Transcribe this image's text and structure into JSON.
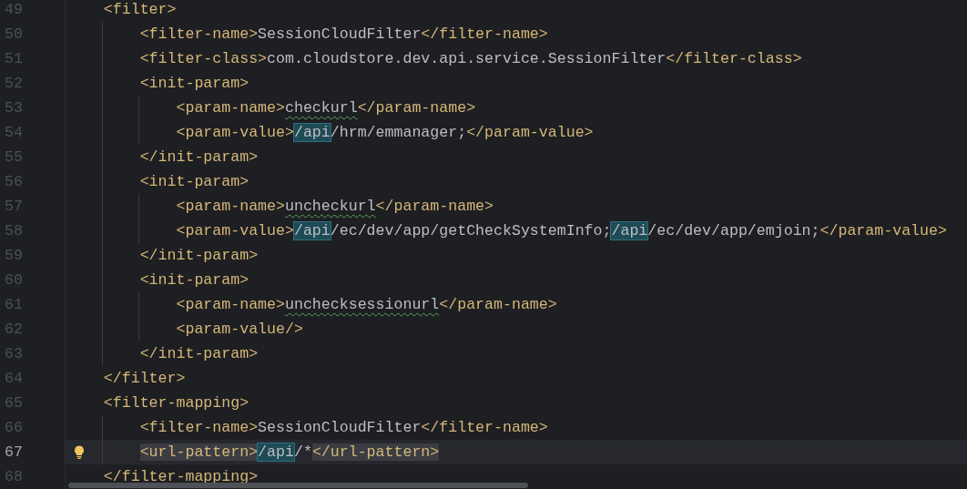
{
  "lines": [
    {
      "number": "49",
      "current": false,
      "tokens": [
        {
          "kind": "tag",
          "text": "<filter>"
        }
      ],
      "children": [
        {
          "number": "50",
          "current": false,
          "tokens": [
            {
              "kind": "tag",
              "text": "<filter-name>"
            },
            {
              "kind": "text",
              "text": "SessionCloudFilter"
            },
            {
              "kind": "tag",
              "text": "</filter-name>"
            }
          ]
        },
        {
          "number": "51",
          "current": false,
          "tokens": [
            {
              "kind": "tag",
              "text": "<filter-class>"
            },
            {
              "kind": "text",
              "text": "com.cloudstore.dev.api.service.SessionFilter"
            },
            {
              "kind": "tag",
              "text": "</filter-class>"
            }
          ]
        },
        {
          "number": "52",
          "current": false,
          "tokens": [
            {
              "kind": "tag",
              "text": "<init-param>"
            }
          ],
          "children": [
            {
              "number": "53",
              "current": false,
              "tokens": [
                {
                  "kind": "tag",
                  "text": "<param-name>"
                },
                {
                  "kind": "typo",
                  "text": "checkurl"
                },
                {
                  "kind": "tag",
                  "text": "</param-name>"
                }
              ]
            },
            {
              "number": "54",
              "current": false,
              "tokens": [
                {
                  "kind": "tag",
                  "text": "<param-value>"
                },
                {
                  "kind": "match",
                  "text": "/api"
                },
                {
                  "kind": "text",
                  "text": "/hrm/emmanager;"
                },
                {
                  "kind": "tag",
                  "text": "</param-value>"
                }
              ]
            }
          ]
        },
        {
          "number": "55",
          "current": false,
          "tokens": [
            {
              "kind": "tag",
              "text": "</init-param>"
            }
          ]
        },
        {
          "number": "56",
          "current": false,
          "tokens": [
            {
              "kind": "tag",
              "text": "<init-param>"
            }
          ],
          "children": [
            {
              "number": "57",
              "current": false,
              "tokens": [
                {
                  "kind": "tag",
                  "text": "<param-name>"
                },
                {
                  "kind": "typo",
                  "text": "uncheckurl"
                },
                {
                  "kind": "tag",
                  "text": "</param-name>"
                }
              ]
            },
            {
              "number": "58",
              "current": false,
              "tokens": [
                {
                  "kind": "tag",
                  "text": "<param-value>"
                },
                {
                  "kind": "match",
                  "text": "/api"
                },
                {
                  "kind": "text",
                  "text": "/ec/dev/app/getCheckSystemInfo;"
                },
                {
                  "kind": "match",
                  "text": "/api"
                },
                {
                  "kind": "text",
                  "text": "/ec/dev/app/emjoin;"
                },
                {
                  "kind": "tag",
                  "text": "</param-value>"
                }
              ]
            }
          ]
        },
        {
          "number": "59",
          "current": false,
          "tokens": [
            {
              "kind": "tag",
              "text": "</init-param>"
            }
          ]
        },
        {
          "number": "60",
          "current": false,
          "tokens": [
            {
              "kind": "tag",
              "text": "<init-param>"
            }
          ],
          "children": [
            {
              "number": "61",
              "current": false,
              "tokens": [
                {
                  "kind": "tag",
                  "text": "<param-name>"
                },
                {
                  "kind": "typo",
                  "text": "unchecksessionurl"
                },
                {
                  "kind": "tag",
                  "text": "</param-name>"
                }
              ]
            },
            {
              "number": "62",
              "current": false,
              "tokens": [
                {
                  "kind": "tag",
                  "text": "<param-value/>"
                }
              ]
            }
          ]
        },
        {
          "number": "63",
          "current": false,
          "tokens": [
            {
              "kind": "tag",
              "text": "</init-param>"
            }
          ]
        }
      ]
    },
    {
      "number": "64",
      "current": false,
      "tokens": [
        {
          "kind": "tag",
          "text": "</filter>"
        }
      ]
    },
    {
      "number": "65",
      "current": false,
      "tokens": [
        {
          "kind": "tag",
          "text": "<filter-mapping>"
        }
      ],
      "children": [
        {
          "number": "66",
          "current": false,
          "tokens": [
            {
              "kind": "tag",
              "text": "<filter-name>"
            },
            {
              "kind": "text",
              "text": "SessionCloudFilter"
            },
            {
              "kind": "tag",
              "text": "</filter-name>"
            }
          ]
        },
        {
          "number": "67",
          "current": true,
          "tokens": [
            {
              "kind": "pair",
              "text": "<url-pattern>"
            },
            {
              "kind": "match",
              "text": "/api"
            },
            {
              "kind": "text",
              "text": "/*"
            },
            {
              "kind": "pair",
              "text": "</url-pattern>"
            }
          ]
        }
      ]
    },
    {
      "number": "68",
      "current": false,
      "tokens": [
        {
          "kind": "tag",
          "text": "</filter-mapping>"
        }
      ]
    }
  ]
}
